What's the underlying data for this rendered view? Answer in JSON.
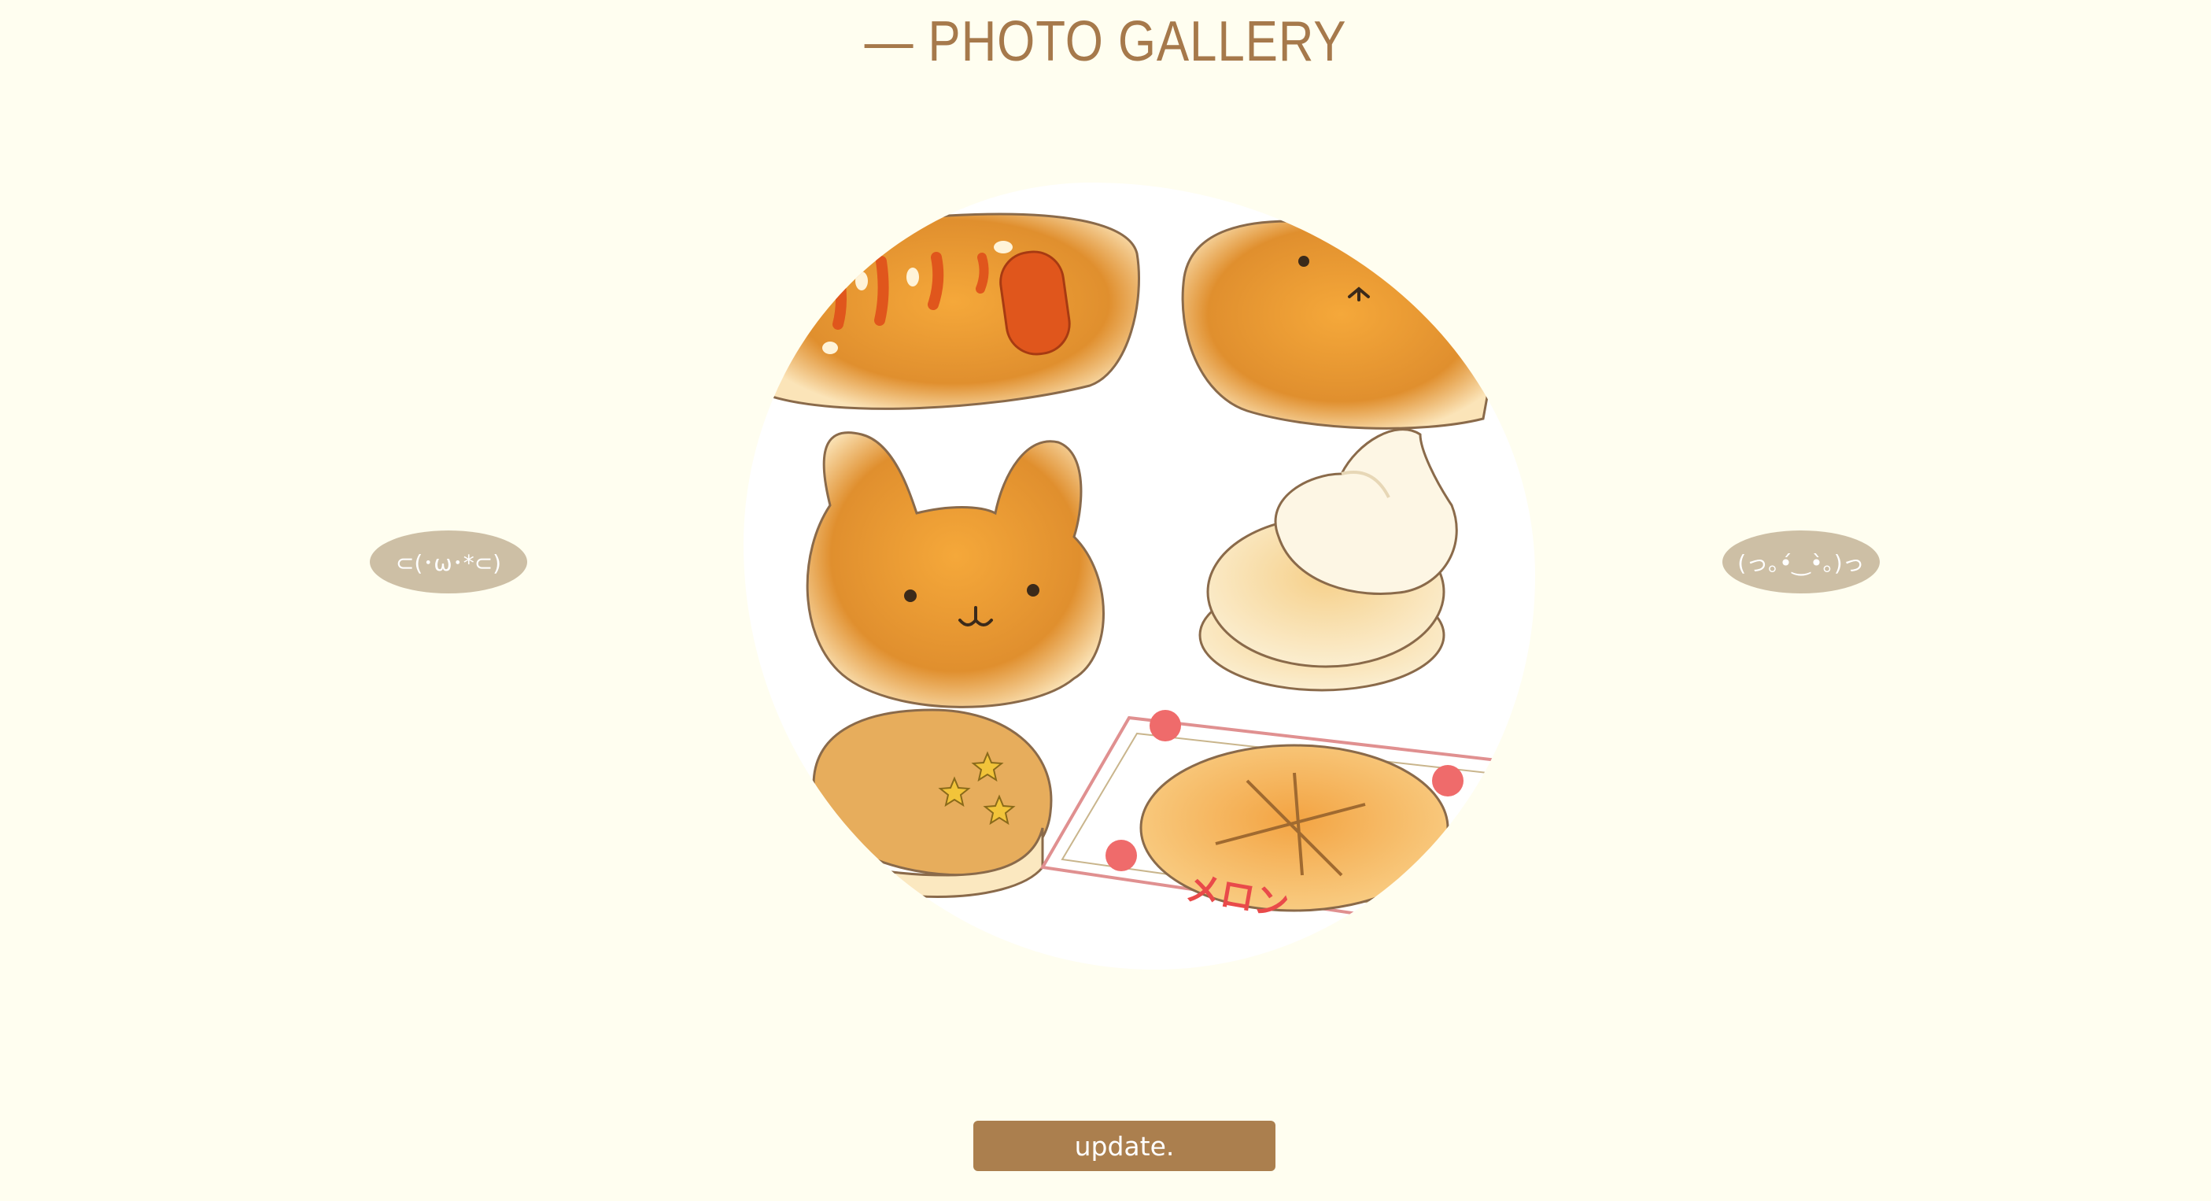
{
  "header": {
    "title": "— PHOTO GALLERY"
  },
  "gallery": {
    "prev_label": "⊂(･ω･*⊂)",
    "next_label": "(っ｡•́‿•̀｡)っ",
    "photo_alt": "bread illustrations",
    "photo_text": "メロン"
  },
  "actions": {
    "update_label": "update."
  },
  "colors": {
    "background": "#fffef0",
    "title": "#a6794b",
    "nav_button": "#cdbfa5",
    "update_button": "#ab7f4e"
  }
}
